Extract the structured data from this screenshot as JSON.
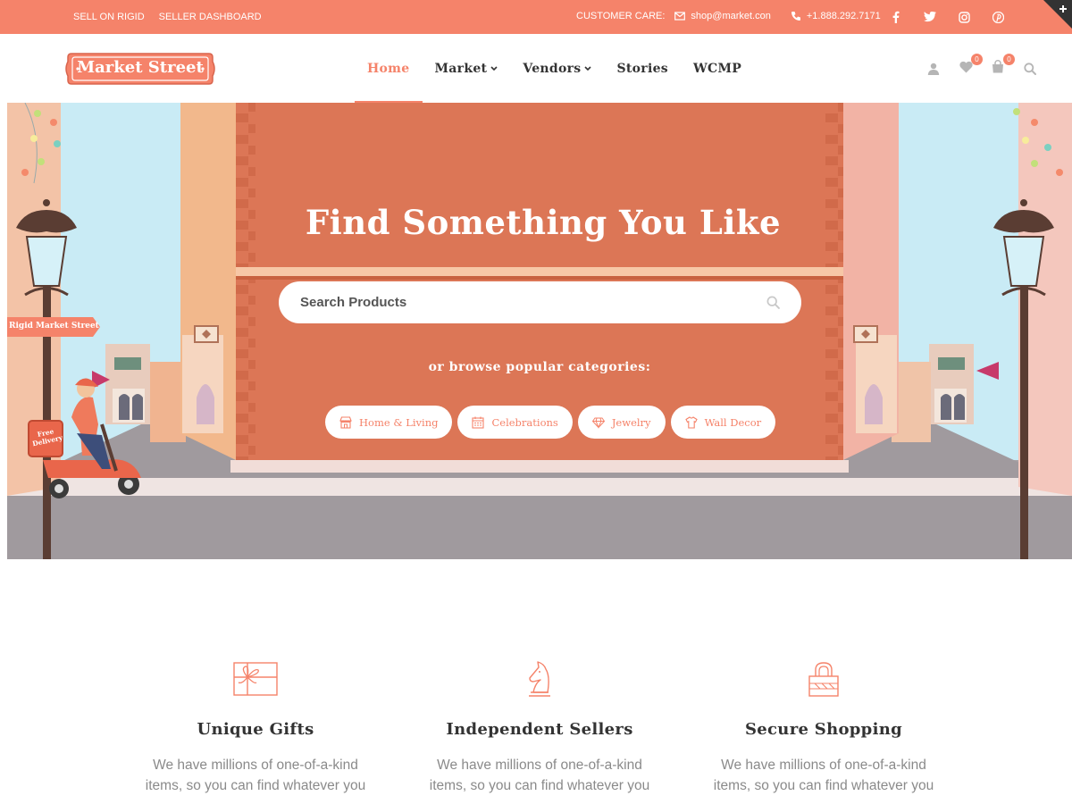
{
  "topbar": {
    "left_links": [
      "SELL ON RIGID",
      "SELLER DASHBOARD"
    ],
    "customer_care_label": "CUSTOMER CARE:",
    "email": "shop@market.con",
    "phone": "+1.888.292.7171",
    "social_icons": [
      "facebook-icon",
      "twitter-icon",
      "instagram-icon",
      "pinterest-icon"
    ]
  },
  "header": {
    "logo_text": "Market Street",
    "nav": [
      {
        "label": "Home",
        "active": true,
        "dropdown": false
      },
      {
        "label": "Market",
        "active": false,
        "dropdown": true
      },
      {
        "label": "Vendors",
        "active": false,
        "dropdown": true
      },
      {
        "label": "Stories",
        "active": false,
        "dropdown": false
      },
      {
        "label": "WCMP",
        "active": false,
        "dropdown": false
      }
    ],
    "wishlist_count": "0",
    "cart_count": "0"
  },
  "hero": {
    "title": "Find Something You Like",
    "search_placeholder": "Search Products",
    "browse_label": "or browse popular categories:",
    "street_sign": "Rigid Market Street",
    "scooter_text": [
      "Free",
      "Delivery"
    ],
    "categories": [
      {
        "label": "Home & Living",
        "icon": "store-icon"
      },
      {
        "label": "Celebrations",
        "icon": "calendar-icon"
      },
      {
        "label": "Jewelry",
        "icon": "diamond-icon"
      },
      {
        "label": "Wall Decor",
        "icon": "shirt-icon"
      }
    ]
  },
  "features": [
    {
      "title": "Unique Gifts",
      "icon": "gift-icon",
      "text": "We have millions of one-of-a-kind items, so you can find whatever you"
    },
    {
      "title": "Independent Sellers",
      "icon": "chess-knight-icon",
      "text": "We have millions of one-of-a-kind items, so you can find whatever you"
    },
    {
      "title": "Secure Shopping",
      "icon": "lock-icon",
      "text": "We have millions of one-of-a-kind items, so you can find whatever you"
    }
  ],
  "colors": {
    "accent": "#f5836a",
    "brick": "#dc7656",
    "road": "#a8a3a6",
    "sky": "#bfe6f2"
  }
}
